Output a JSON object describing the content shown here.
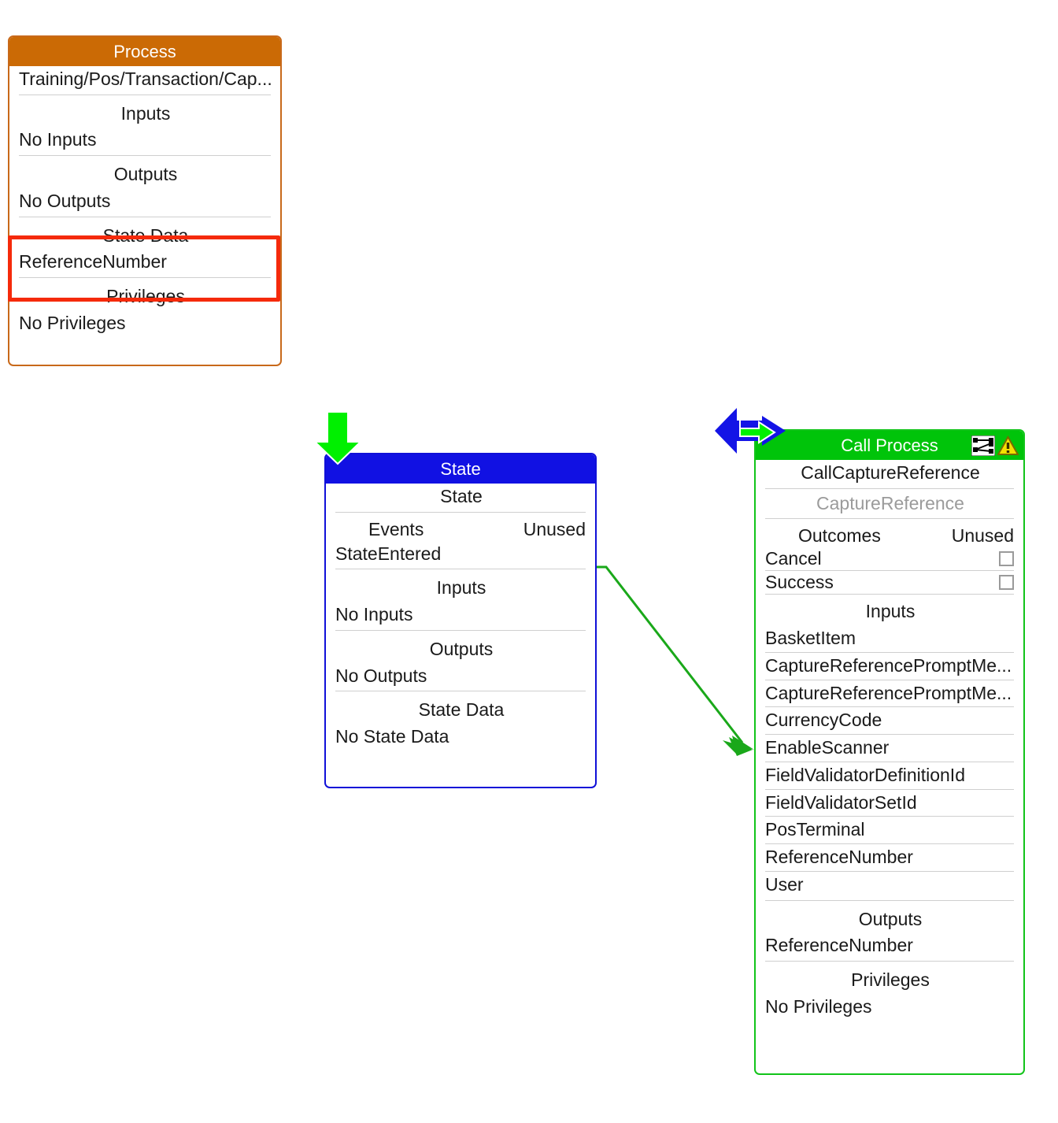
{
  "process_node": {
    "header_title": "Process",
    "header_color": "#cb6a05",
    "border_color": "#c8691a",
    "path": "Training/Pos/Transaction/Cap...",
    "sections": [
      {
        "label": "Inputs",
        "value": "No Inputs"
      },
      {
        "label": "Outputs",
        "value": "No Outputs"
      },
      {
        "label": "State Data",
        "value": "ReferenceNumber"
      },
      {
        "label": "Privileges",
        "value": "No Privileges"
      }
    ],
    "highlight_color": "#f52a0b"
  },
  "state_node": {
    "header_title": "State",
    "header_color": "#1111e3",
    "border_color": "#1010d8",
    "name": "State",
    "events_label": "Events",
    "events_unused_label": "Unused",
    "events": [
      "StateEntered"
    ],
    "sections": [
      {
        "label": "Inputs",
        "value": "No Inputs"
      },
      {
        "label": "Outputs",
        "value": "No Outputs"
      },
      {
        "label": "State Data",
        "value": "No State Data"
      }
    ]
  },
  "call_process_node": {
    "header_title": "Call Process",
    "header_color": "#00c40a",
    "border_color": "#12c41a",
    "header_icons": [
      "flow-diagram-icon",
      "warning-triangle-icon"
    ],
    "name": "CallCaptureReference",
    "target_process": "CaptureReference",
    "outcomes_label": "Outcomes",
    "outcomes_unused_label": "Unused",
    "outcomes": [
      {
        "label": "Cancel",
        "unused_checked": false
      },
      {
        "label": "Success",
        "unused_checked": false
      }
    ],
    "inputs_label": "Inputs",
    "inputs": [
      "BasketItem",
      "CaptureReferencePromptMe...",
      "CaptureReferencePromptMe...",
      "CurrencyCode",
      "EnableScanner",
      "FieldValidatorDefinitionId",
      "FieldValidatorSetId",
      "PosTerminal",
      "ReferenceNumber",
      "User"
    ],
    "outputs_label": "Outputs",
    "outputs": [
      "ReferenceNumber"
    ],
    "privileges_label": "Privileges",
    "privileges": [
      "No Privileges"
    ]
  },
  "annotations": {
    "green_down_arrow": "green-down-arrow-icon",
    "move_cursor": "move-cursor-icon",
    "connector_color": "#1aa81a"
  }
}
